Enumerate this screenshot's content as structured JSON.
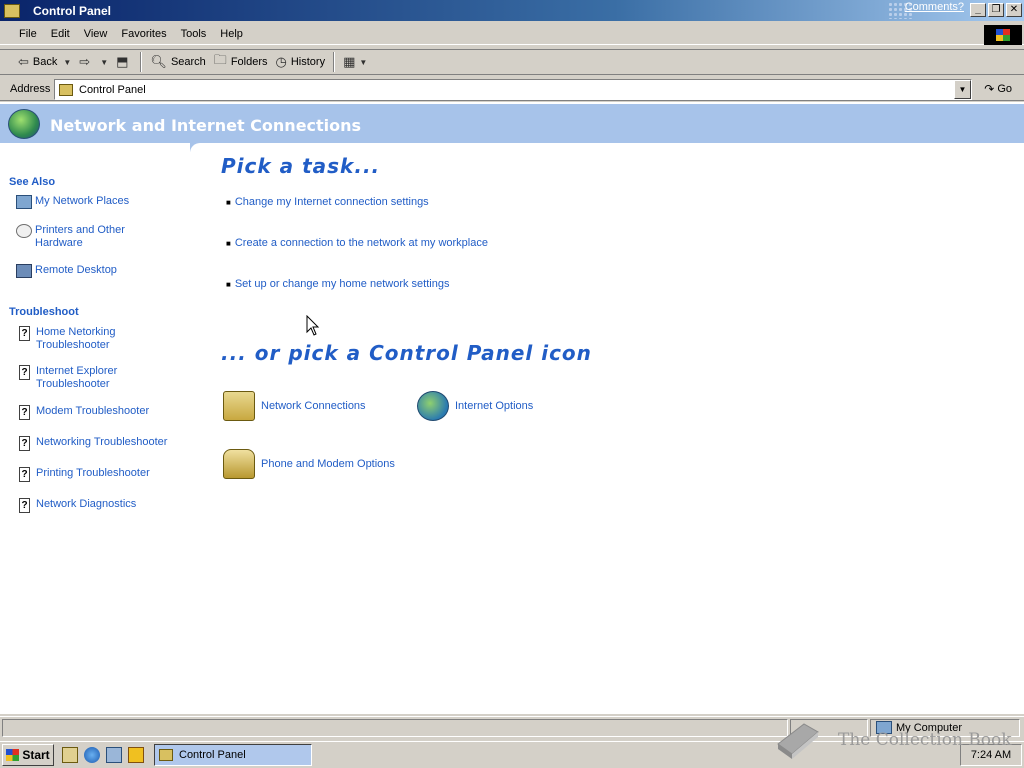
{
  "window": {
    "title": "Control Panel",
    "comments": "Comments?",
    "app_icon": "control-panel-icon",
    "min_label": "_",
    "max_label": "❐",
    "close_label": "✕"
  },
  "menu": {
    "items": [
      "File",
      "Edit",
      "View",
      "Favorites",
      "Tools",
      "Help"
    ]
  },
  "toolbar": {
    "back": "Back",
    "search": "Search",
    "folders": "Folders",
    "history": "History"
  },
  "address": {
    "label": "Address",
    "value": "Control Panel",
    "go": "Go"
  },
  "header": {
    "title": "Network and Internet Connections"
  },
  "sidebar": {
    "see_also_heading": "See Also",
    "see_also": [
      {
        "label": "My Network Places",
        "icon": "network-places-icon"
      },
      {
        "label": "Printers and Other Hardware",
        "icon": "mouse-icon"
      },
      {
        "label": "Remote Desktop",
        "icon": "remote-desktop-icon"
      }
    ],
    "troubleshoot_heading": "Troubleshoot",
    "troubleshoot": [
      {
        "label": "Home Netorking Troubleshooter"
      },
      {
        "label": "Internet Explorer Troubleshooter"
      },
      {
        "label": "Modem Troubleshooter"
      },
      {
        "label": "Networking Troubleshooter"
      },
      {
        "label": "Printing Troubleshooter"
      },
      {
        "label": "Network Diagnostics"
      }
    ]
  },
  "main": {
    "pick_task_heading": "Pick a task...",
    "tasks": [
      "Change my Internet connection settings",
      "Create a connection to the network at my workplace",
      "Set up or change my home network settings"
    ],
    "pick_icon_heading": "... or pick a Control Panel icon",
    "icons": [
      {
        "label": "Network Connections",
        "icon": "network-connections-icon"
      },
      {
        "label": "Internet Options",
        "icon": "internet-options-icon"
      },
      {
        "label": "Phone and Modem Options",
        "icon": "phone-modem-icon"
      }
    ]
  },
  "statusbar": {
    "zone": "My Computer"
  },
  "taskbar": {
    "start": "Start",
    "window_button": "Control Panel",
    "clock": "7:24 AM"
  },
  "watermark": {
    "text": "The Collection Book"
  }
}
